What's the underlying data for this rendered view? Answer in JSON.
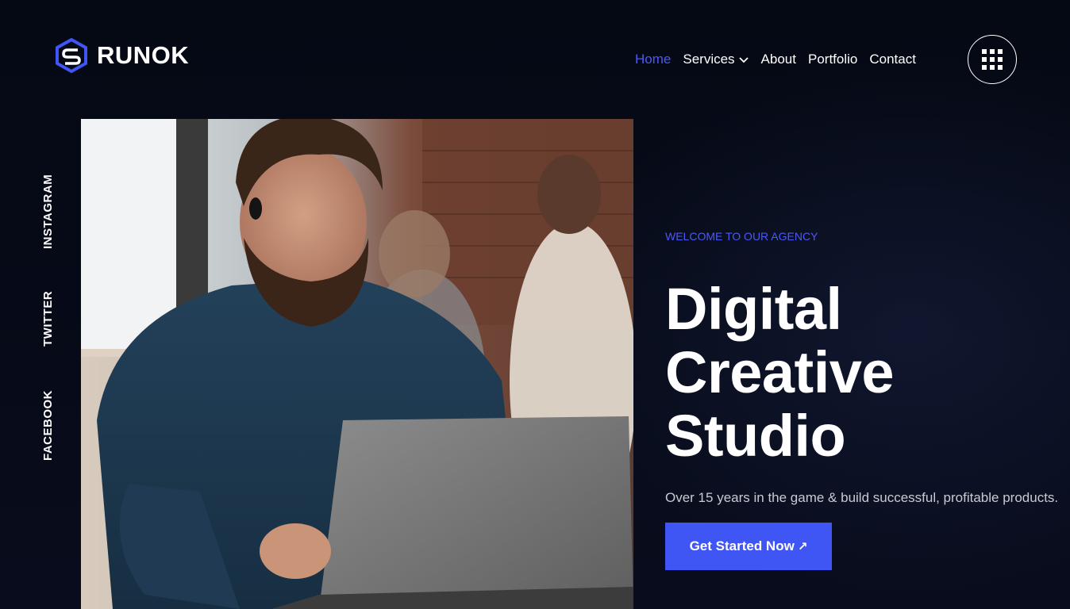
{
  "brand": {
    "name": "RUNOK",
    "icon": "hexagon-s-logo-icon",
    "accent_color": "#4b59f7",
    "background_color": "#070b18"
  },
  "nav": {
    "items": [
      {
        "label": "Home",
        "active": true
      },
      {
        "label": "Services",
        "active": false,
        "has_dropdown": true
      },
      {
        "label": "About",
        "active": false
      },
      {
        "label": "Portfolio",
        "active": false
      },
      {
        "label": "Contact",
        "active": false
      }
    ],
    "menu_icon": "grid-menu-icon"
  },
  "social": {
    "links": [
      "INSTAGRAM",
      "TWITTER",
      "FACEBOOK"
    ]
  },
  "hero": {
    "eyebrow": "WELCOME TO OUR AGENCY",
    "title_lines": [
      "Digital",
      "Creative",
      "Studio"
    ],
    "description": "Over 15 years in the game & build successful, profitable products.",
    "cta_label": "Get Started Now",
    "cta_icon": "arrow-up-right-icon",
    "cta_color": "#3f56f5"
  }
}
